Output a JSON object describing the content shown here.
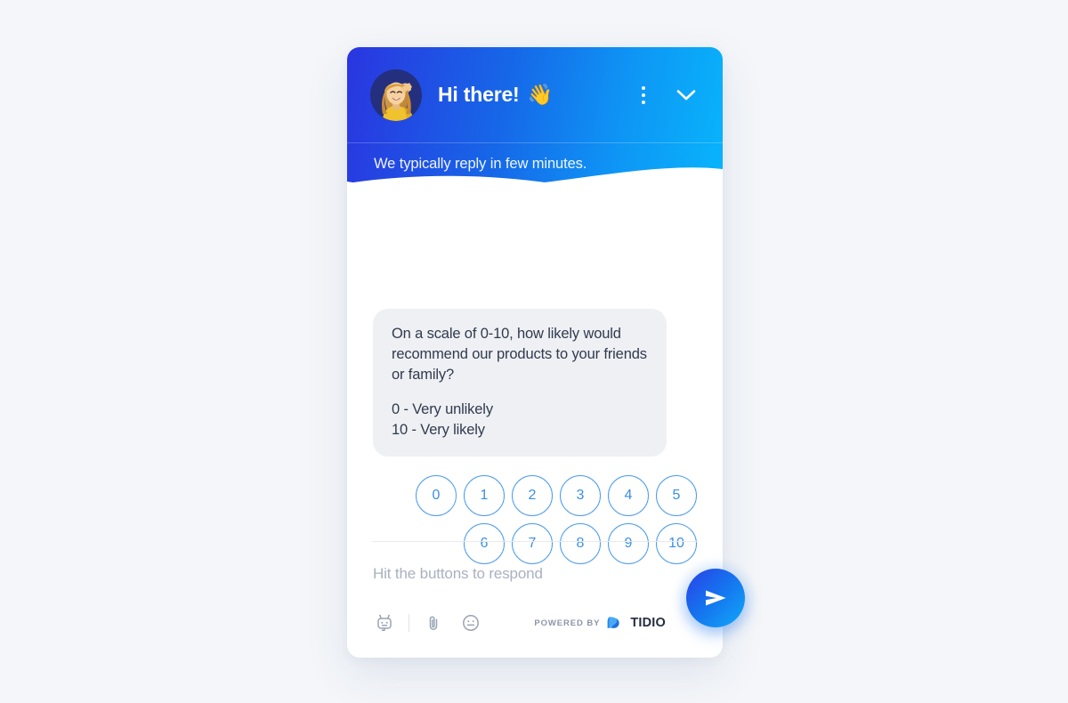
{
  "widget": {
    "header": {
      "title": "Hi there!",
      "title_emoji": "👋",
      "subtitle": "We typically reply in few minutes.",
      "avatar_alt": "agent-photo",
      "menu_icon": "more-vertical-icon",
      "minimize_icon": "chevron-down-icon",
      "gradient_from": "#2a35e0",
      "gradient_to": "#08b5fb"
    },
    "conversation": {
      "bot_message": {
        "question": "On a scale of 0-10, how likely would recommend our products to your friends or family?",
        "legend_low": "0 - Very unlikely",
        "legend_high": "10 - Very likely",
        "bubble_bg": "#eef0f4",
        "text_color": "#313a4d"
      },
      "rating_rows": [
        [
          "0",
          "1",
          "2",
          "3",
          "4",
          "5"
        ],
        [
          "6",
          "7",
          "8",
          "9",
          "10"
        ]
      ],
      "rating_color": "#4a9bec"
    },
    "footer": {
      "composer_placeholder": "Hit the buttons to respond",
      "tools": [
        {
          "name": "chatbot-icon"
        },
        {
          "name": "attachment-icon"
        },
        {
          "name": "emoji-icon"
        }
      ],
      "branding": {
        "powered_by": "POWERED BY",
        "brand": "TIDIO",
        "logo_icon": "tidio-logo-icon"
      },
      "send_icon": "send-icon",
      "send_color": "#1670ee"
    }
  },
  "page": {
    "background": "#f4f6f9"
  }
}
